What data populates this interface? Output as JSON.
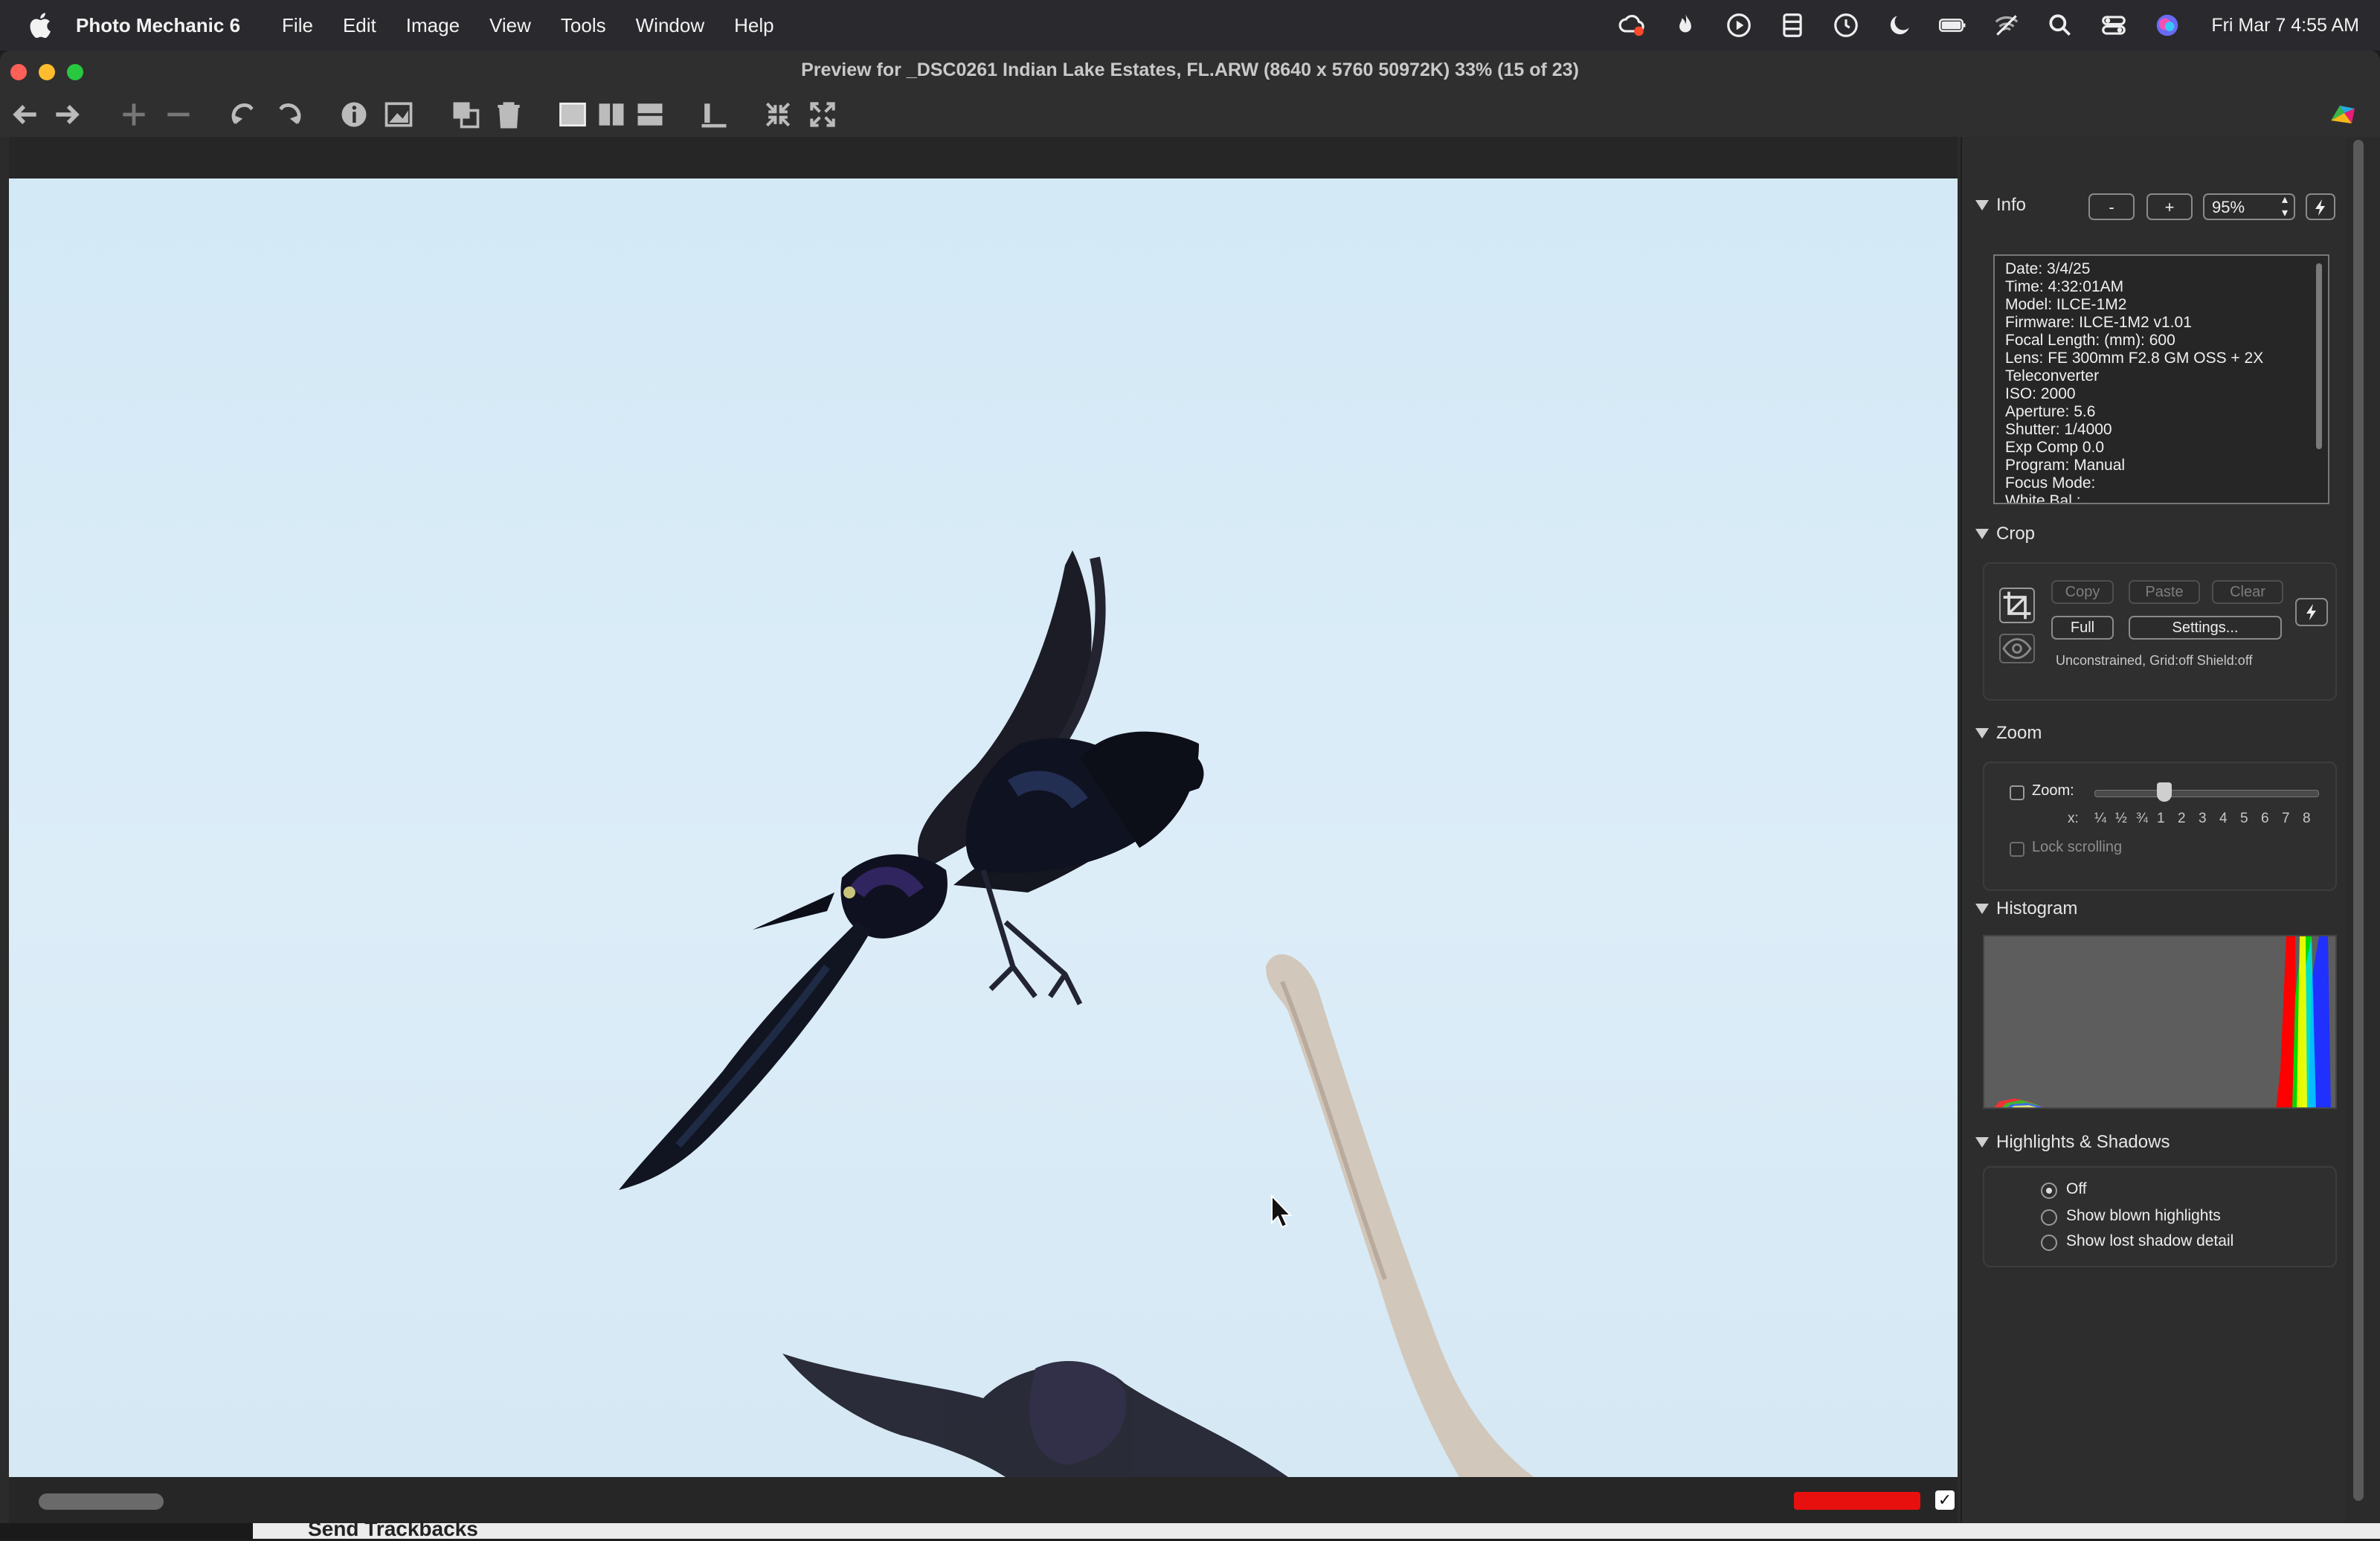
{
  "menubar": {
    "app_name": "Photo Mechanic 6",
    "menus": [
      "File",
      "Edit",
      "Image",
      "View",
      "Tools",
      "Window",
      "Help"
    ],
    "clock": "Fri Mar 7  4:55 AM"
  },
  "window": {
    "title": "Preview for _DSC0261 Indian Lake Estates, FL.ARW (8640 x 5760 50972K) 33% (15 of 23)"
  },
  "info": {
    "title": "Info",
    "minus_label": "-",
    "plus_label": "+",
    "zoom_value": "95%",
    "lines": [
      "Date: 3/4/25",
      "Time: 4:32:01AM",
      "Model: ILCE-1M2",
      "Firmware: ILCE-1M2 v1.01",
      "Focal Length:  (mm): 600",
      "Lens: FE 300mm F2.8 GM OSS + 2X",
      "Teleconverter",
      "ISO: 2000",
      "Aperture: 5.6",
      "Shutter: 1/4000",
      "Exp Comp 0.0",
      "Program: Manual",
      "Focus Mode:",
      "White Bal.:"
    ]
  },
  "crop": {
    "title": "Crop",
    "copy_label": "Copy",
    "paste_label": "Paste",
    "clear_label": "Clear",
    "full_label": "Full",
    "settings_label": "Settings...",
    "status": "Unconstrained, Grid:off Shield:off"
  },
  "zoom": {
    "title": "Zoom",
    "zoom_label": "Zoom:",
    "scale_prefix": "x:",
    "scale_ticks": [
      "¼",
      "½",
      "¾",
      "1",
      "2",
      "3",
      "4",
      "5",
      "6",
      "7",
      "8"
    ],
    "lock_label": "Lock scrolling"
  },
  "histogram": {
    "title": "Histogram"
  },
  "highlights": {
    "title": "Highlights & Shadows",
    "options": [
      "Off",
      "Show blown highlights",
      "Show lost shadow detail"
    ],
    "selected": "Off"
  },
  "behind_window": {
    "label": "Send Trackbacks"
  },
  "colors": {
    "color_class": "#e8100f",
    "sky": "#d8ebf6"
  }
}
